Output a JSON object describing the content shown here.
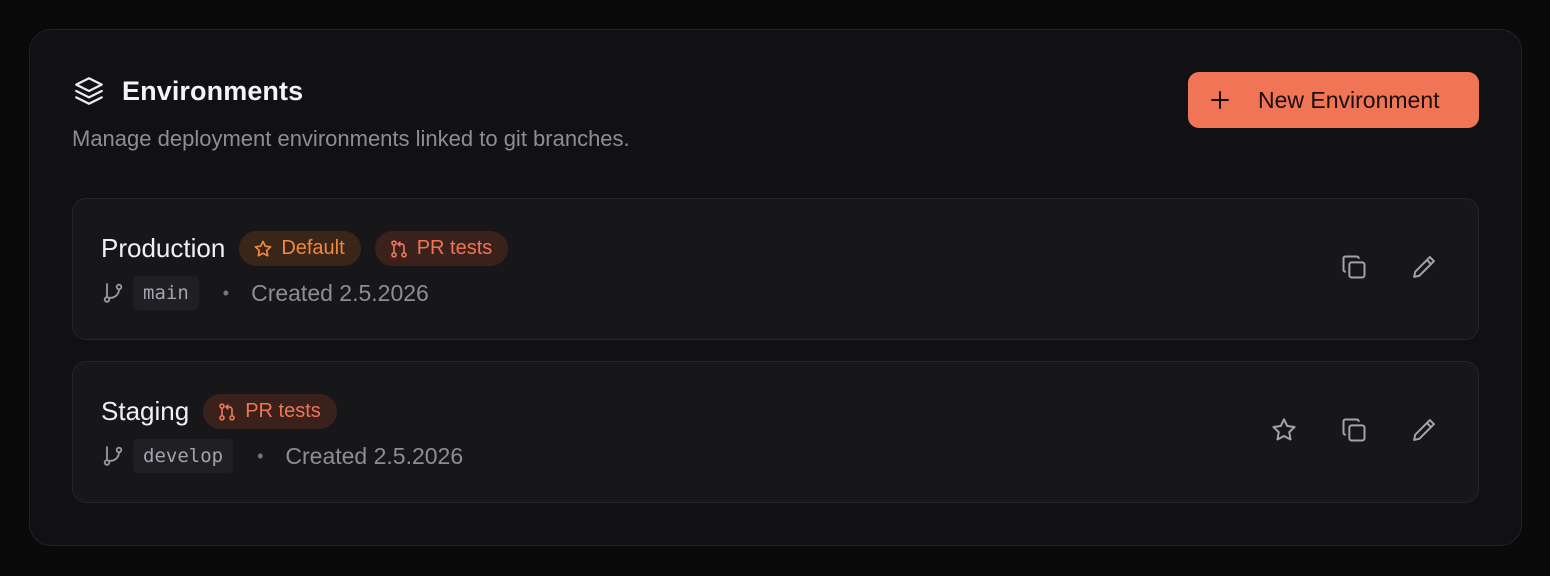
{
  "header": {
    "title": "Environments",
    "subtitle": "Manage deployment environments linked to git branches.",
    "new_button_label": "New Environment",
    "icon": "layers-icon"
  },
  "environments": [
    {
      "name": "Production",
      "badges": [
        {
          "label": "Default",
          "icon": "star-icon"
        },
        {
          "label": "PR tests",
          "icon": "pull-request-icon"
        }
      ],
      "branch": "main",
      "created": "Created 2.5.2026",
      "actions": [
        "copy-icon",
        "edit-icon"
      ]
    },
    {
      "name": "Staging",
      "badges": [
        {
          "label": "PR tests",
          "icon": "pull-request-icon"
        }
      ],
      "branch": "develop",
      "created": "Created 2.5.2026",
      "actions": [
        "star-icon",
        "copy-icon",
        "edit-icon"
      ]
    }
  ],
  "colors": {
    "accent": "#ef7556",
    "default_badge": "#f0883e",
    "background": "#0a0a0b",
    "panel": "#111114",
    "card": "#17171a"
  }
}
